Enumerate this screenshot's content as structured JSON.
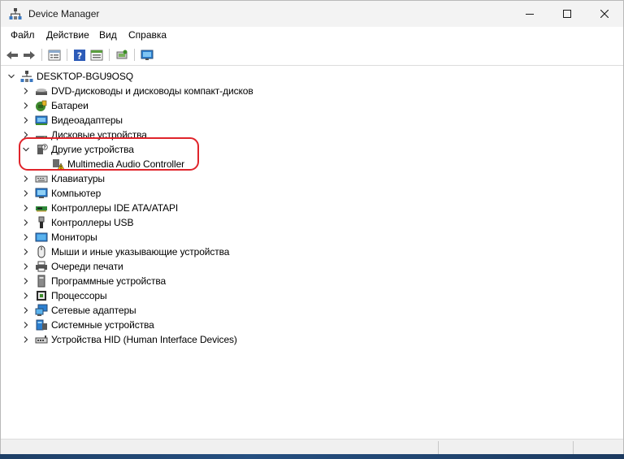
{
  "window": {
    "title": "Device Manager"
  },
  "menu": {
    "items": [
      "Файл",
      "Действие",
      "Вид",
      "Справка"
    ]
  },
  "toolbar": {
    "buttons": [
      "back-arrow-icon",
      "forward-arrow-icon",
      "properties-icon",
      "help-icon",
      "view-icon",
      "scan-hardware-icon",
      "monitor-icon"
    ]
  },
  "tree": {
    "root": {
      "label": "DESKTOP-BGU9OSQ",
      "icon": "computer-icon",
      "expanded": true
    },
    "items": [
      {
        "label": "DVD-дисководы и дисководы компакт-дисков",
        "icon": "dvd-drive-icon",
        "expanded": false
      },
      {
        "label": "Батареи",
        "icon": "battery-icon",
        "expanded": false
      },
      {
        "label": "Видеоадаптеры",
        "icon": "display-adapter-icon",
        "expanded": false
      },
      {
        "label": "Дисковые устройства",
        "icon": "disk-drive-icon",
        "expanded": false
      },
      {
        "label": "Другие устройства",
        "icon": "other-devices-icon",
        "expanded": true,
        "children": [
          {
            "label": "Multimedia Audio Controller",
            "icon": "warning-device-icon",
            "status": "warning"
          }
        ]
      },
      {
        "label": "Клавиатуры",
        "icon": "keyboard-icon",
        "expanded": false
      },
      {
        "label": "Компьютер",
        "icon": "computer-monitor-icon",
        "expanded": false
      },
      {
        "label": "Контроллеры IDE ATA/ATAPI",
        "icon": "ide-controller-icon",
        "expanded": false
      },
      {
        "label": "Контроллеры USB",
        "icon": "usb-icon",
        "expanded": false
      },
      {
        "label": "Мониторы",
        "icon": "monitor-icon",
        "expanded": false
      },
      {
        "label": "Мыши и иные указывающие устройства",
        "icon": "mouse-icon",
        "expanded": false
      },
      {
        "label": "Очереди печати",
        "icon": "printer-icon",
        "expanded": false
      },
      {
        "label": "Программные устройства",
        "icon": "software-device-icon",
        "expanded": false
      },
      {
        "label": "Процессоры",
        "icon": "processor-icon",
        "expanded": false
      },
      {
        "label": "Сетевые адаптеры",
        "icon": "network-adapter-icon",
        "expanded": false
      },
      {
        "label": "Системные устройства",
        "icon": "system-device-icon",
        "expanded": false
      },
      {
        "label": "Устройства HID (Human Interface Devices)",
        "icon": "hid-icon",
        "expanded": false
      }
    ]
  },
  "colors": {
    "highlight_ring": "#e0242b",
    "accent_blue": "#1e6fd0",
    "warning": "#f2c200"
  }
}
